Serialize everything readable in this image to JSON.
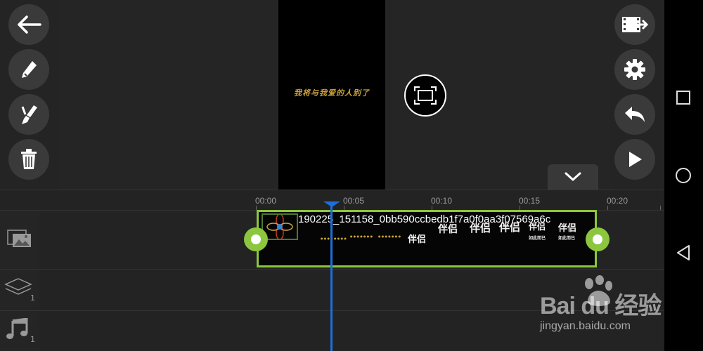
{
  "preview": {
    "caption": "我将与我爱的人别了"
  },
  "timeline": {
    "ruler_labels": [
      "00:00",
      "00:05",
      "00:10",
      "00:15",
      "00:20"
    ],
    "clip": {
      "title": "190225_151158_0bb590ccbedb1f7a0f0aa3f07569a6c",
      "film_words": [
        "伴侣",
        "伴侣",
        "伴侣",
        "伴侣",
        "伴侣",
        "伴侣"
      ],
      "film_sub": "如此而已"
    },
    "track_counts": {
      "layers": "1",
      "audio": "1"
    }
  },
  "icons": {
    "back": "arrow-left-icon",
    "edit": "pencil-icon",
    "effects": "brush-icon",
    "delete": "trash-icon",
    "export": "film-export-icon",
    "settings": "gear-icon",
    "undo": "undo-icon",
    "play": "play-icon",
    "fullscreen": "fullscreen-icon",
    "collapse": "chevron-down-icon"
  },
  "watermark": {
    "brand": "Bai du 经验",
    "url": "jingyan.baidu.com"
  },
  "colors": {
    "accent_green": "#8cc63f",
    "playhead_blue": "#1e6fd9",
    "caption_gold": "#c9a23a"
  }
}
